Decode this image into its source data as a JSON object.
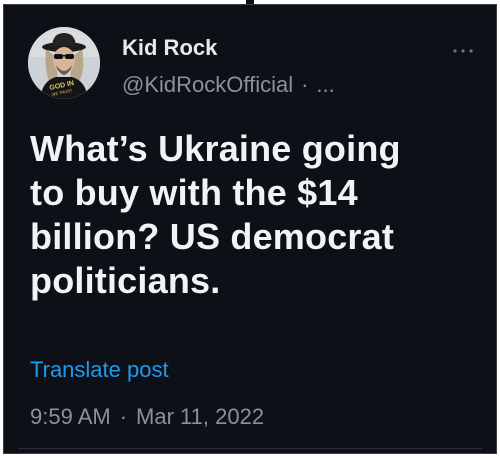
{
  "tweet": {
    "display_name": "Kid Rock",
    "handle": "@KidRockOfficial",
    "handle_separator": "·",
    "handle_more": "...",
    "text_lines": [
      "What’s Ukraine going",
      "to buy with the $14",
      "billion? US democrat",
      "politicians."
    ],
    "translate_label": "Translate post",
    "time": "9:59 AM",
    "meta_separator": "·",
    "date": "Mar 11, 2022"
  },
  "icons": {
    "more": "more-dots-icon",
    "avatar": "profile-avatar"
  },
  "colors": {
    "background": "#0d1017",
    "text_primary": "#e7e9ea",
    "text_secondary": "#8b9199",
    "link": "#1d9bf0"
  }
}
